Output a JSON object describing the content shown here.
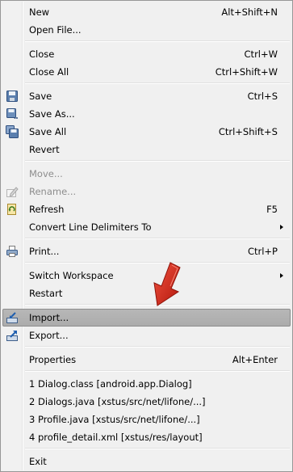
{
  "menu": {
    "new": {
      "label": "New",
      "shortcut": "Alt+Shift+N"
    },
    "open_file": {
      "label": "Open File..."
    },
    "close": {
      "label": "Close",
      "shortcut": "Ctrl+W"
    },
    "close_all": {
      "label": "Close All",
      "shortcut": "Ctrl+Shift+W"
    },
    "save": {
      "label": "Save",
      "shortcut": "Ctrl+S",
      "icon": "floppy-disk-icon"
    },
    "save_as": {
      "label": "Save As...",
      "icon": "save-as-icon"
    },
    "save_all": {
      "label": "Save All",
      "shortcut": "Ctrl+Shift+S",
      "icon": "save-all-icon"
    },
    "revert": {
      "label": "Revert"
    },
    "move": {
      "label": "Move...",
      "enabled": false
    },
    "rename": {
      "label": "Rename...",
      "enabled": false,
      "icon": "rename-icon"
    },
    "refresh": {
      "label": "Refresh",
      "shortcut": "F5",
      "icon": "refresh-icon"
    },
    "convert_line_delimiters": {
      "label": "Convert Line Delimiters To",
      "has_submenu": true
    },
    "print": {
      "label": "Print...",
      "shortcut": "Ctrl+P",
      "icon": "printer-icon"
    },
    "switch_workspace": {
      "label": "Switch Workspace",
      "has_submenu": true
    },
    "restart": {
      "label": "Restart"
    },
    "import": {
      "label": "Import...",
      "icon": "import-icon",
      "highlighted": true
    },
    "export": {
      "label": "Export...",
      "icon": "export-icon"
    },
    "properties": {
      "label": "Properties",
      "shortcut": "Alt+Enter"
    },
    "recent_files": [
      {
        "label": "1 Dialog.class  [android.app.Dialog]"
      },
      {
        "label": "2 Dialogs.java  [xstus/src/net/lifone/...]"
      },
      {
        "label": "3 Profile.java  [xstus/src/net/lifone/...]"
      },
      {
        "label": "4 profile_detail.xml  [xstus/res/layout]"
      }
    ],
    "exit": {
      "label": "Exit"
    }
  },
  "overlay": {
    "annotation_arrow_color": "#d8261a",
    "icon": "red-arrow-annotation-icon"
  },
  "colors": {
    "menu_bg": "#f0f0f0",
    "highlight_bg": "#b3b3b3",
    "disabled_text": "#8d8d8d"
  }
}
